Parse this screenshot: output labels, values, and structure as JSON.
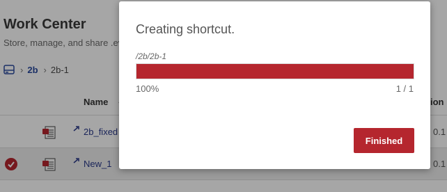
{
  "page": {
    "title": "Work Center",
    "subtitle": "Store, manage, and share .ev"
  },
  "breadcrumb": {
    "home_icon": "drive-icon",
    "items": [
      {
        "label": "2b"
      },
      {
        "label": "2b-1"
      }
    ]
  },
  "table": {
    "header_name": "Name",
    "header_right": "ion",
    "rows": [
      {
        "name": "2b_fixed",
        "right": "0.1",
        "selected": false,
        "icon": "pdf-file-icon"
      },
      {
        "name": "New_1",
        "right": "0.1",
        "selected": true,
        "icon": "pdf-file-icon"
      }
    ]
  },
  "modal": {
    "title": "Creating shortcut.",
    "path": "/2b/2b-1",
    "progress": 1.0,
    "progress_label": "100%",
    "count_label": "1 / 1",
    "button_label": "Finished"
  },
  "colors": {
    "accent": "#b5262e",
    "link": "#2a3a8a"
  }
}
